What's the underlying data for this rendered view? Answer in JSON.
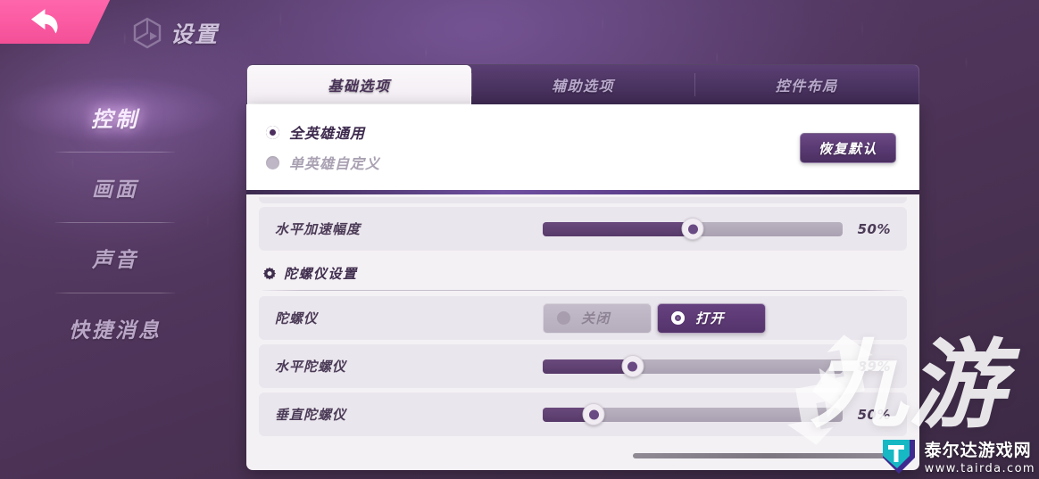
{
  "header": {
    "back_icon": "back-arrow-icon",
    "app_icon": "hex-cube-icon",
    "title": "设置"
  },
  "sidebar": {
    "items": [
      {
        "label": "控制",
        "active": true
      },
      {
        "label": "画面",
        "active": false
      },
      {
        "label": "声音",
        "active": false
      },
      {
        "label": "快捷消息",
        "active": false
      }
    ]
  },
  "tabs": [
    {
      "label": "基础选项",
      "active": true
    },
    {
      "label": "辅助选项",
      "active": false
    },
    {
      "label": "控件布局",
      "active": false
    }
  ],
  "scope": {
    "options": [
      {
        "label": "全英雄通用",
        "selected": true
      },
      {
        "label": "单英雄自定义",
        "selected": false
      }
    ],
    "restore_label": "恢复默认"
  },
  "settings": {
    "top_rows": [
      {
        "label": "水平加速幅度",
        "value": "50%",
        "fill_pct": 50,
        "thumb_pct": 50,
        "type": "slider"
      }
    ],
    "section": {
      "icon": "gear-icon",
      "title": "陀螺仪设置"
    },
    "gyro_toggle": {
      "label": "陀螺仪",
      "options": [
        {
          "label": "关闭",
          "on": false
        },
        {
          "label": "打开",
          "on": true
        }
      ]
    },
    "gyro_rows": [
      {
        "label": "水平陀螺仪",
        "value": "89%",
        "fill_pct": 30,
        "thumb_pct": 30,
        "type": "slider"
      },
      {
        "label": "垂直陀螺仪",
        "value": "50%",
        "fill_pct": 17,
        "thumb_pct": 17,
        "type": "slider"
      }
    ]
  },
  "watermark": {
    "brand": "九游",
    "site_cn": "泰尔达游戏网",
    "site_url": "www.tairda.com"
  },
  "colors": {
    "accent_pink": "#fb5ba2",
    "accent_purple": "#5a3a73",
    "panel_bg": "#f4f1f5",
    "slider_fill": "#5a3d6c"
  }
}
